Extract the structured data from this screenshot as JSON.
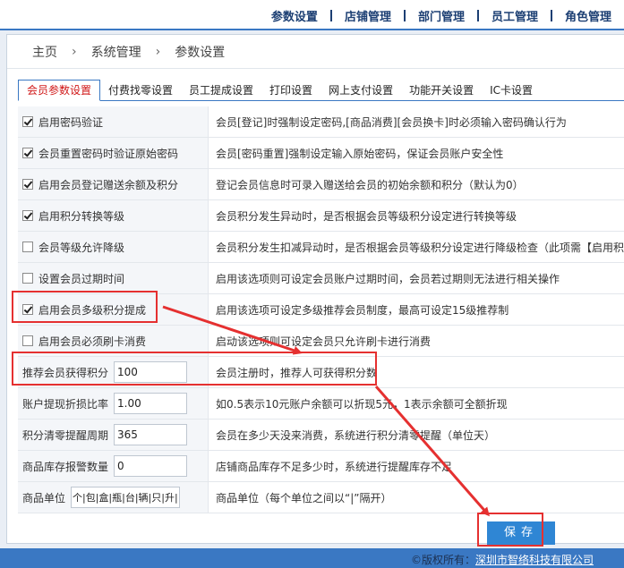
{
  "topnav": [
    "参数设置",
    "店铺管理",
    "部门管理",
    "员工管理",
    "角色管理"
  ],
  "breadcrumb": [
    "主页",
    "系统管理",
    "参数设置"
  ],
  "tabs": [
    "会员参数设置",
    "付费找零设置",
    "员工提成设置",
    "打印设置",
    "网上支付设置",
    "功能开关设置",
    "IC卡设置"
  ],
  "checkbox_rows": [
    {
      "label": "启用密码验证",
      "checked": true,
      "desc": "会员[登记]时强制设定密码,[商品消费][会员换卡]时必须输入密码确认行为"
    },
    {
      "label": "会员重置密码时验证原始密码",
      "checked": true,
      "desc": "会员[密码重置]强制设定输入原始密码，保证会员账户安全性"
    },
    {
      "label": "启用会员登记赠送余额及积分",
      "checked": true,
      "desc": "登记会员信息时可录入赠送给会员的初始余额和积分（默认为0）"
    },
    {
      "label": "启用积分转换等级",
      "checked": true,
      "desc": "会员积分发生异动时，是否根据会员等级积分设定进行转换等级"
    },
    {
      "label": "会员等级允许降级",
      "checked": false,
      "desc": "会员积分发生扣减异动时，是否根据会员等级积分设定进行降级检查（此项需【启用积分"
    },
    {
      "label": "设置会员过期时间",
      "checked": false,
      "desc": "启用该选项则可设定会员账户过期时间，会员若过期则无法进行相关操作"
    },
    {
      "label": "启用会员多级积分提成",
      "checked": true,
      "desc": "启用该选项可设定多级推荐会员制度，最高可设定15级推荐制"
    },
    {
      "label": "启用会员必须刷卡消费",
      "checked": false,
      "desc": "启动该选项则可设定会员只允许刷卡进行消费"
    }
  ],
  "input_rows": [
    {
      "label": "推荐会员获得积分",
      "value": "100",
      "desc": "会员注册时，推荐人可获得积分数"
    },
    {
      "label": "账户提现折损比率",
      "value": "1.00",
      "desc": "如0.5表示10元账户余额可以折现5元，1表示余额可全额折现"
    },
    {
      "label": "积分清零提醒周期",
      "value": "365",
      "desc": "会员在多少天没来消费，系统进行积分清零提醒（单位天）"
    },
    {
      "label": "商品库存报警数量",
      "value": "0",
      "desc": "店铺商品库存不足多少时，系统进行提醒库存不足"
    },
    {
      "label": "商品单位",
      "value": "个|包|盒|瓶|台|辆|只|升|",
      "desc": "商品单位（每个单位之间以“|”隔开）"
    }
  ],
  "save_label": "保存",
  "footer": {
    "prefix": "©版权所有：",
    "company": "深圳市智络科技有限公司"
  },
  "colors": {
    "accent": "#3a78c3",
    "active_tab": "#d01717",
    "annotation": "#e53030",
    "save_button": "#2f86d4"
  }
}
